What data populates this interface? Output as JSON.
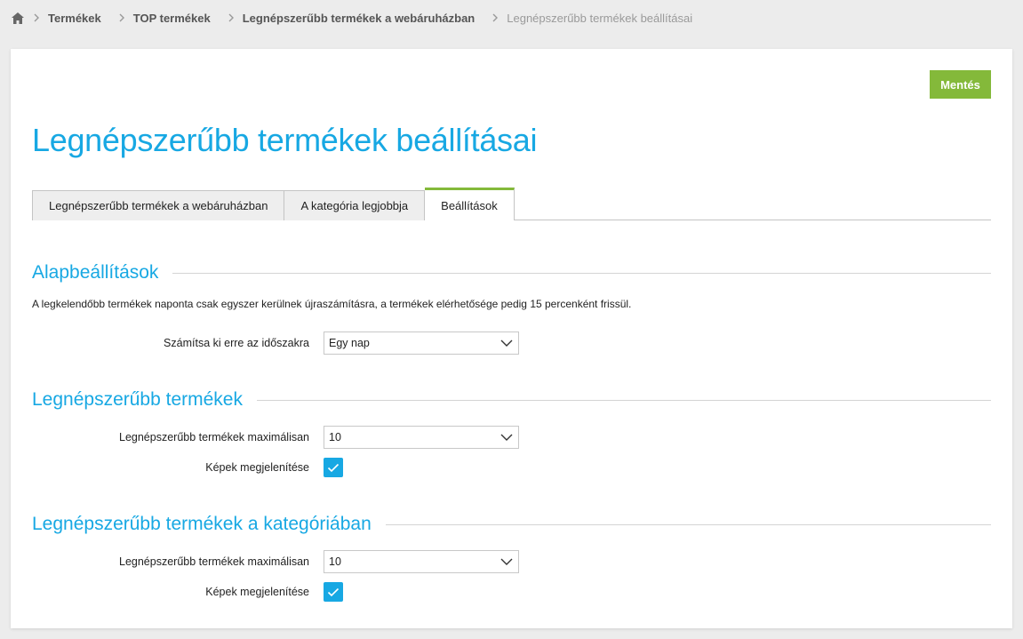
{
  "breadcrumb": {
    "items": [
      "Termékek",
      "TOP termékek",
      "Legnépszerűbb termékek a webáruházban"
    ],
    "current": "Legnépszerűbb termékek beállításai"
  },
  "save_label": "Mentés",
  "page_title": "Legnépszerűbb termékek beállításai",
  "tabs": [
    {
      "label": "Legnépszerűbb termékek a webáruházban",
      "active": false
    },
    {
      "label": "A kategória legjobbja",
      "active": false
    },
    {
      "label": "Beállítások",
      "active": true
    }
  ],
  "sections": {
    "basic": {
      "title": "Alapbeállítások",
      "note": "A legkelendőbb termékek naponta csak egyszer kerülnek újraszámításra, a termékek elérhetősége pedig 15 percenként frissül.",
      "period_label": "Számítsa ki erre az időszakra",
      "period_value": "Egy nap"
    },
    "popular": {
      "title": "Legnépszerűbb termékek",
      "max_label": "Legnépszerűbb termékek maximálisan",
      "max_value": "10",
      "images_label": "Képek megjelenítése",
      "images_checked": true
    },
    "category": {
      "title": "Legnépszerűbb termékek a kategóriában",
      "max_label": "Legnépszerűbb termékek maximálisan",
      "max_value": "10",
      "images_label": "Képek megjelenítése",
      "images_checked": true
    }
  },
  "colors": {
    "accent": "#17a8e3",
    "save_button": "#84b93a",
    "active_tab": "#84b93a"
  },
  "icons": [
    "home-icon",
    "chevron-right-icon",
    "chevron-down-icon",
    "checkmark-icon"
  ]
}
